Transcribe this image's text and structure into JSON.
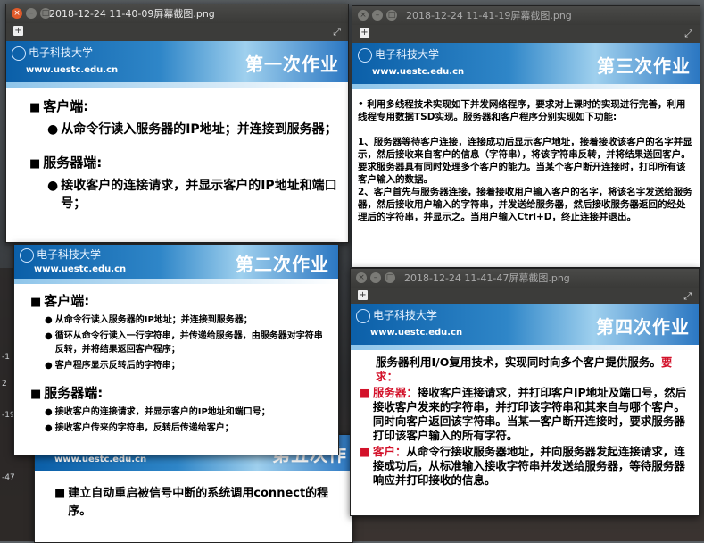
{
  "desktop": {
    "ticks": [
      "-1",
      "2",
      "-19",
      "-47"
    ]
  },
  "win1": {
    "title": "2018-12-24 11-40-09屏幕截图.png",
    "slide": {
      "logo": "电子科技大学",
      "url": "www.uestc.edu.cn",
      "heading": "第一次作业",
      "client_h": "客户端:",
      "client_item": "从命令行读入服务器的IP地址；并连接到服务器；",
      "server_h": "服务器端:",
      "server_item": "接收客户的连接请求，并显示客户的IP地址和端口号；"
    }
  },
  "win2": {
    "title": "2018-12-24 11-41-19屏幕截图.png",
    "slide": {
      "logo": "电子科技大学",
      "url": "www.uestc.edu.cn",
      "heading": "第三次作业",
      "intro": "• 利用多线程技术实现如下并发网络程序，要求对上课时的实现进行完善，利用线程专用数据TSD实现。服务器和客户程序分别实现如下功能:",
      "p1": "1、服务器等待客户连接，连接成功后显示客户地址，接着接收该客户的名字并显示，然后接收来自客户的信息（字符串），将该字符串反转，并将结果送回客户。要求服务器具有同时处理多个客户的能力。当某个客户断开连接时，打印所有该客户输入的数据。",
      "p2": "2、客户首先与服务器连接，接着接收用户输入客户的名字，将该名字发送给服务器，然后接收用户输入的字符串，并发送给服务器，然后接收服务器返回的经处理后的字符串，并显示之。当用户输入Ctrl+D，终止连接并退出。"
    }
  },
  "win3": {
    "slide": {
      "logo": "电子科技大学",
      "url": "www.uestc.edu.cn",
      "heading": "第二次作业",
      "client_h": "客户端:",
      "c1": "从命令行读入服务器的IP地址；并连接到服务器；",
      "c2": "循环从命令行读入一行字符串，并传递给服务器，由服务器对字符串反转，并将结果返回客户程序；",
      "c3": "客户程序显示反转后的字符串；",
      "server_h": "服务器端:",
      "s1": "接收客户的连接请求，并显示客户的IP地址和端口号；",
      "s2": "接收客户传来的字符串，反转后传递给客户；"
    }
  },
  "win4": {
    "slide": {
      "url": "www.uestc.edu.cn",
      "heading": "第五次作",
      "item": "建立自动重启被信号中断的系统调用connect的程序。"
    }
  },
  "win5": {
    "title": "2018-12-24 11-41-47屏幕截图.png",
    "slide": {
      "logo": "电子科技大学",
      "url": "www.uestc.edu.cn",
      "heading": "第四次作业",
      "intro": "服务器利用I/O复用技术，实现同时向多个客户提供服务。",
      "req": "要求：",
      "server_label": "服务器：",
      "server_text": "接收客户连接请求，并打印客户IP地址及端口号，然后接收客户发来的字符串，并打印该字符串和其来自与哪个客户。同时向客户返回该字符串。当某一客户断开连接时，要求服务器打印该客户输入的所有字符。",
      "client_label": "客户：",
      "client_text": "从命令行接收服务器地址，并向服务器发起连接请求，连接成功后，从标准输入接收字符串并发送给服务器，等待服务器响应并打印接收的信息。"
    }
  },
  "colors": {
    "red": "#d3122a",
    "banner": "#2f86c8",
    "close": "#e05a2a"
  }
}
